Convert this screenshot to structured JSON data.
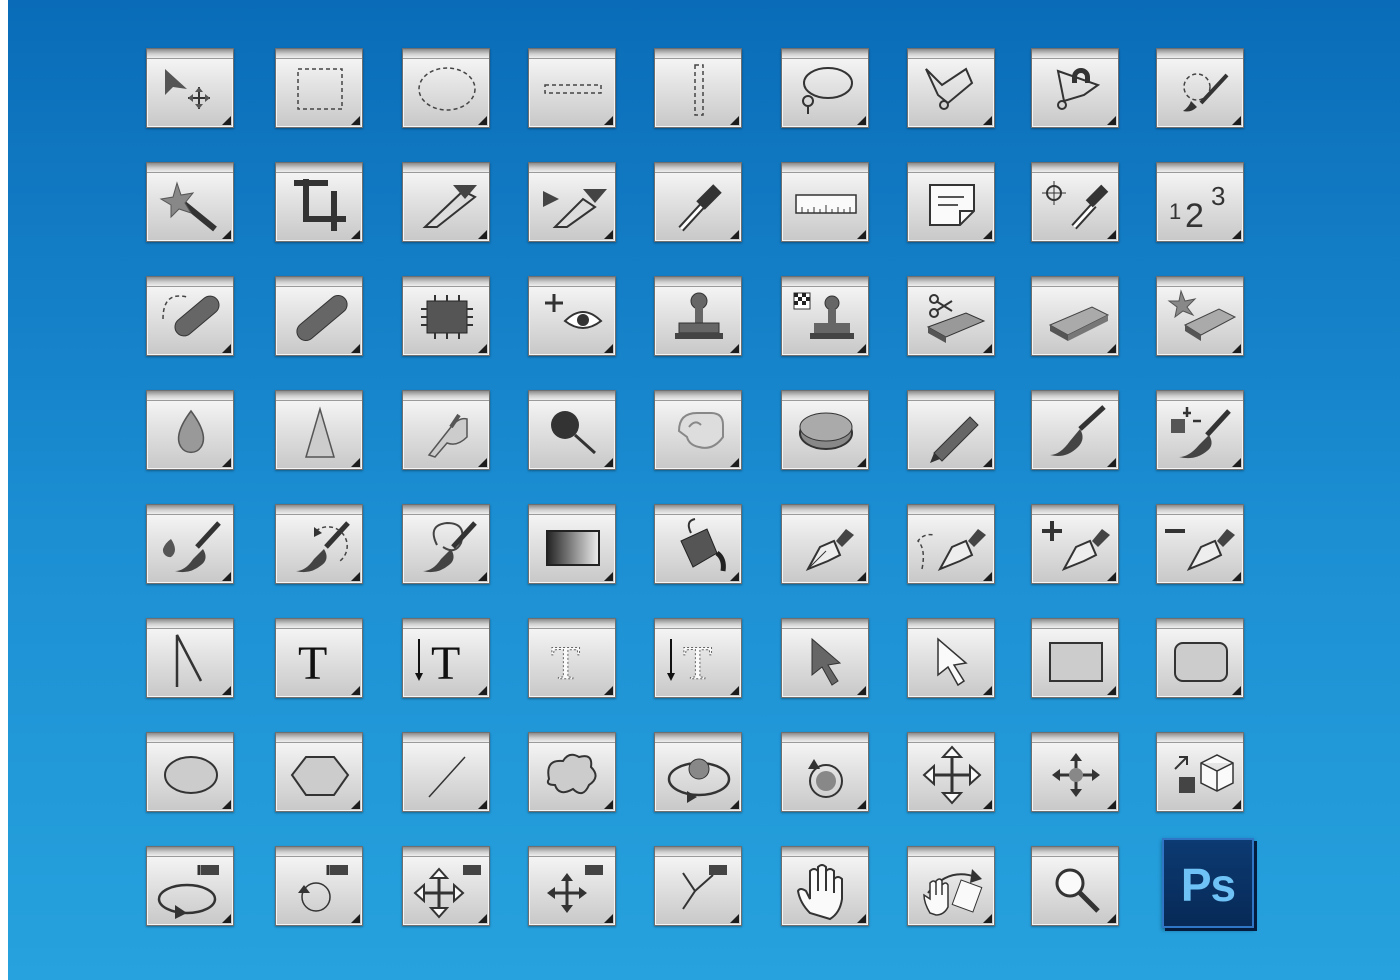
{
  "colors": {
    "background_top": "#0a6cb8",
    "background_bottom": "#27a2de",
    "tile_face": "#e3e3e3",
    "icon": "#333333",
    "logo_bg": "#0c3a72",
    "logo_text": "#6fc2f5"
  },
  "logo": {
    "text": "Ps",
    "icon": "photoshop-logo"
  },
  "icons": [
    "move-tool-icon",
    "rectangular-marquee-icon",
    "elliptical-marquee-icon",
    "single-row-marquee-icon",
    "single-column-marquee-icon",
    "lasso-icon",
    "polygonal-lasso-icon",
    "magnetic-lasso-icon",
    "quick-selection-icon",
    "magic-wand-icon",
    "crop-icon",
    "perspective-crop-icon",
    "slice-icon",
    "eyedropper-icon",
    "ruler-icon",
    "note-icon",
    "color-sampler-icon",
    "count-icon",
    "spot-healing-brush-icon",
    "healing-brush-icon",
    "patch-icon",
    "red-eye-icon",
    "clone-stamp-icon",
    "pattern-stamp-icon",
    "background-eraser-icon",
    "eraser-icon",
    "magic-eraser-icon",
    "blur-icon",
    "sharpen-icon",
    "smudge-icon",
    "dodge-icon",
    "burn-icon",
    "sponge-icon",
    "pencil-icon",
    "brush-icon",
    "color-replacement-icon",
    "mixer-brush-icon",
    "history-brush-icon",
    "art-history-brush-icon",
    "gradient-icon",
    "paint-bucket-icon",
    "pen-icon",
    "freeform-pen-icon",
    "add-anchor-point-icon",
    "delete-anchor-point-icon",
    "convert-point-icon",
    "horizontal-type-icon",
    "vertical-type-icon",
    "horizontal-type-mask-icon",
    "vertical-type-mask-icon",
    "path-selection-icon",
    "direct-selection-icon",
    "rectangle-icon",
    "rounded-rectangle-icon",
    "ellipse-icon",
    "polygon-icon",
    "line-icon",
    "custom-shape-icon",
    "3d-object-rotate-icon",
    "3d-object-roll-icon",
    "3d-object-pan-icon",
    "3d-object-slide-icon",
    "3d-object-scale-icon",
    "3d-camera-rotate-icon",
    "3d-camera-roll-icon",
    "3d-camera-pan-icon",
    "3d-camera-walk-icon",
    "3d-camera-zoom-icon",
    "hand-icon",
    "rotate-view-icon",
    "zoom-icon"
  ]
}
